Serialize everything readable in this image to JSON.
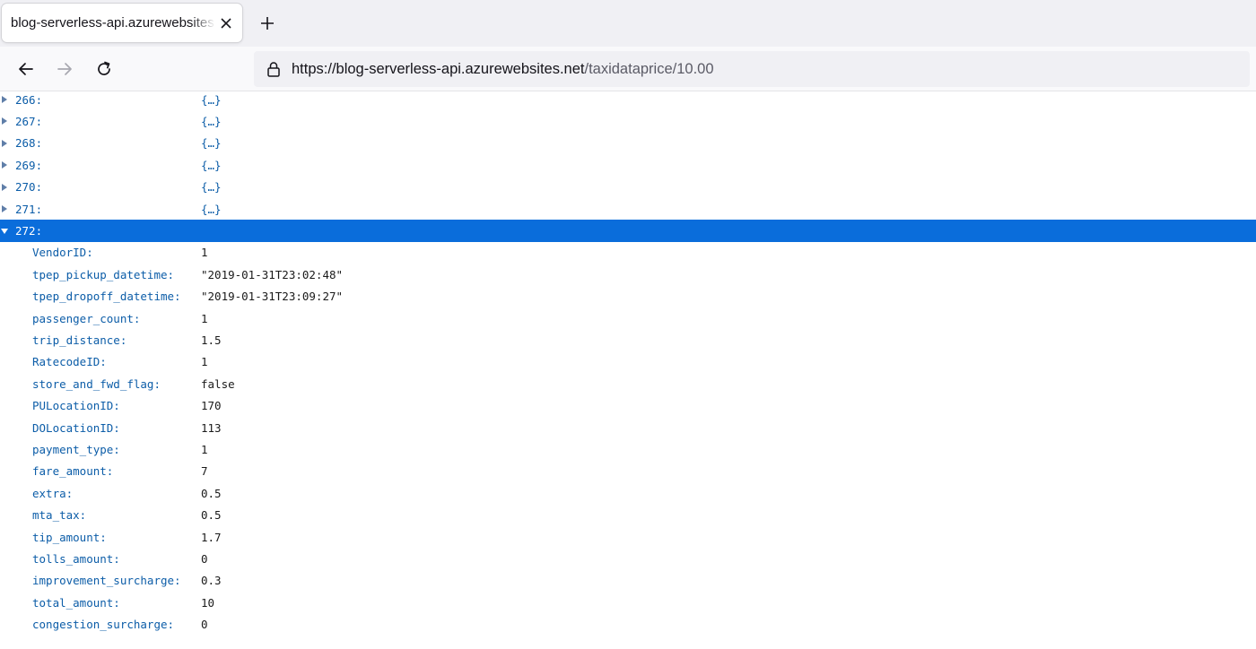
{
  "browser": {
    "tab_title": "blog-serverless-api.azurewebsites.net",
    "url_host": "https://blog-serverless-api.azurewebsites.net",
    "url_path": "/taxidataprice/10.00"
  },
  "icons": {
    "tab_close": "close-icon",
    "new_tab": "plus-icon",
    "back": "arrow-left-icon",
    "forward": "arrow-right-icon",
    "reload": "reload-icon",
    "lock": "lock-icon"
  },
  "collapsed_rows": [
    {
      "key": "266:",
      "value": "{…}"
    },
    {
      "key": "267:",
      "value": "{…}"
    },
    {
      "key": "268:",
      "value": "{…}"
    },
    {
      "key": "269:",
      "value": "{…}"
    },
    {
      "key": "270:",
      "value": "{…}"
    },
    {
      "key": "271:",
      "value": "{…}"
    }
  ],
  "expanded_row": {
    "key": "272:"
  },
  "fields": [
    {
      "key": "VendorID:",
      "value": "1"
    },
    {
      "key": "tpep_pickup_datetime:",
      "value": "\"2019-01-31T23:02:48\""
    },
    {
      "key": "tpep_dropoff_datetime:",
      "value": "\"2019-01-31T23:09:27\""
    },
    {
      "key": "passenger_count:",
      "value": "1"
    },
    {
      "key": "trip_distance:",
      "value": "1.5"
    },
    {
      "key": "RatecodeID:",
      "value": "1"
    },
    {
      "key": "store_and_fwd_flag:",
      "value": "false"
    },
    {
      "key": "PULocationID:",
      "value": "170"
    },
    {
      "key": "DOLocationID:",
      "value": "113"
    },
    {
      "key": "payment_type:",
      "value": "1"
    },
    {
      "key": "fare_amount:",
      "value": "7"
    },
    {
      "key": "extra:",
      "value": "0.5"
    },
    {
      "key": "mta_tax:",
      "value": "0.5"
    },
    {
      "key": "tip_amount:",
      "value": "1.7"
    },
    {
      "key": "tolls_amount:",
      "value": "0"
    },
    {
      "key": "improvement_surcharge:",
      "value": "0.3"
    },
    {
      "key": "total_amount:",
      "value": "10"
    },
    {
      "key": "congestion_surcharge:",
      "value": "0"
    }
  ]
}
